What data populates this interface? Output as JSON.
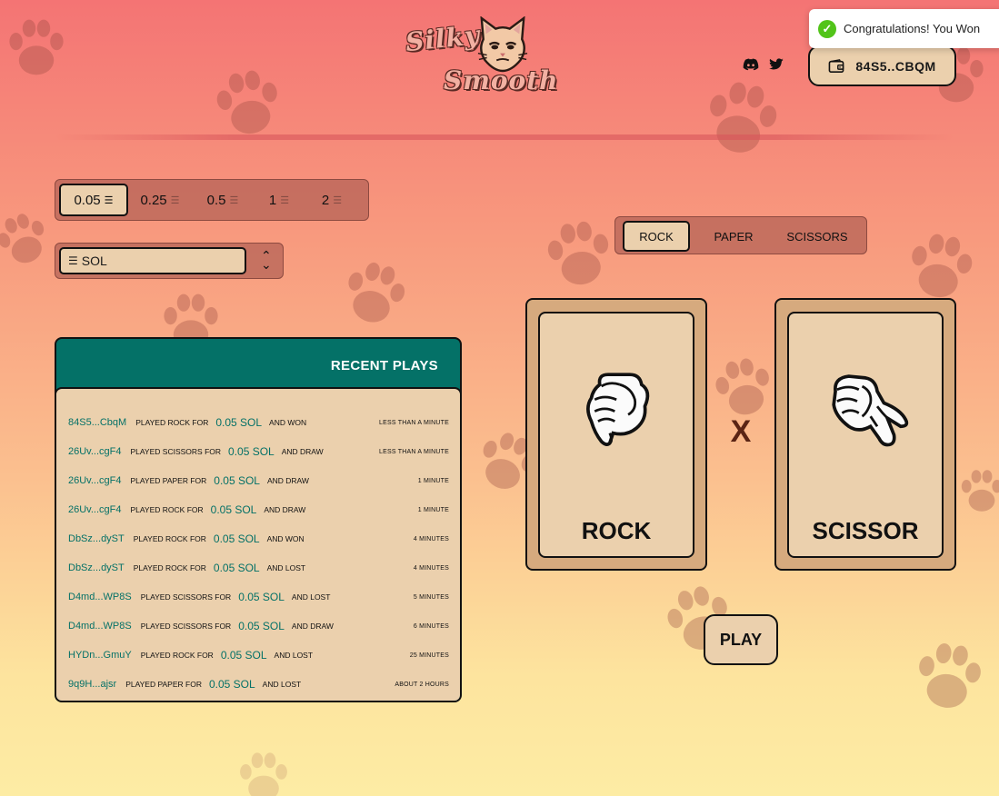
{
  "logo": {
    "line1": "Silky",
    "line2": "Smooth"
  },
  "social": [
    {
      "icon": "discord-icon"
    },
    {
      "icon": "twitter-icon"
    }
  ],
  "wallet": {
    "label": "84S5..CBQM",
    "icon": "wallet-icon"
  },
  "toast": {
    "message": "Congratulations! You Won",
    "icon": "check-circle-icon"
  },
  "amounts": [
    {
      "value": "0.05",
      "selected": true
    },
    {
      "value": "0.25",
      "selected": false
    },
    {
      "value": "0.5",
      "selected": false
    },
    {
      "value": "1",
      "selected": false
    },
    {
      "value": "2",
      "selected": false
    }
  ],
  "token": {
    "selected": "SOL"
  },
  "recent": {
    "title": "RECENT PLAYS",
    "rows": [
      {
        "wallet": "84S5...CbqM",
        "played": "PLAYED ROCK FOR",
        "amount": "0.05 SOL",
        "result": "AND WON",
        "time": "LESS THAN A MINUTE"
      },
      {
        "wallet": "26Uv...cgF4",
        "played": "PLAYED SCISSORS FOR",
        "amount": "0.05 SOL",
        "result": "AND DRAW",
        "time": "LESS THAN A MINUTE"
      },
      {
        "wallet": "26Uv...cgF4",
        "played": "PLAYED PAPER FOR",
        "amount": "0.05 SOL",
        "result": "AND DRAW",
        "time": "1 MINUTE"
      },
      {
        "wallet": "26Uv...cgF4",
        "played": "PLAYED ROCK FOR",
        "amount": "0.05 SOL",
        "result": "AND DRAW",
        "time": "1 MINUTE"
      },
      {
        "wallet": "DbSz...dyST",
        "played": "PLAYED ROCK FOR",
        "amount": "0.05 SOL",
        "result": "AND WON",
        "time": "4 MINUTES"
      },
      {
        "wallet": "DbSz...dyST",
        "played": "PLAYED ROCK FOR",
        "amount": "0.05 SOL",
        "result": "AND LOST",
        "time": "4 MINUTES"
      },
      {
        "wallet": "D4md...WP8S",
        "played": "PLAYED SCISSORS FOR",
        "amount": "0.05 SOL",
        "result": "AND LOST",
        "time": "5 MINUTES"
      },
      {
        "wallet": "D4md...WP8S",
        "played": "PLAYED SCISSORS FOR",
        "amount": "0.05 SOL",
        "result": "AND DRAW",
        "time": "6 MINUTES"
      },
      {
        "wallet": "HYDn...GmuY",
        "played": "PLAYED ROCK FOR",
        "amount": "0.05 SOL",
        "result": "AND LOST",
        "time": "25 MINUTES"
      },
      {
        "wallet": "9q9H...ajsr",
        "played": "PLAYED PAPER FOR",
        "amount": "0.05 SOL",
        "result": "AND LOST",
        "time": "ABOUT 2 HOURS"
      }
    ]
  },
  "choices": [
    {
      "label": "ROCK",
      "selected": true
    },
    {
      "label": "PAPER",
      "selected": false
    },
    {
      "label": "SCISSORS",
      "selected": false
    }
  ],
  "player_card": {
    "label": "ROCK",
    "icon": "rock-hand-icon"
  },
  "versus": "X",
  "opponent_card": {
    "label": "SCISSOR",
    "icon": "scissors-hand-icon"
  },
  "play_button": {
    "label": "PLAY"
  },
  "colors": {
    "accent": "#047167",
    "card": "#ebd0ad",
    "card_border": "#d6aa7e",
    "toast_success": "#52c41a"
  }
}
